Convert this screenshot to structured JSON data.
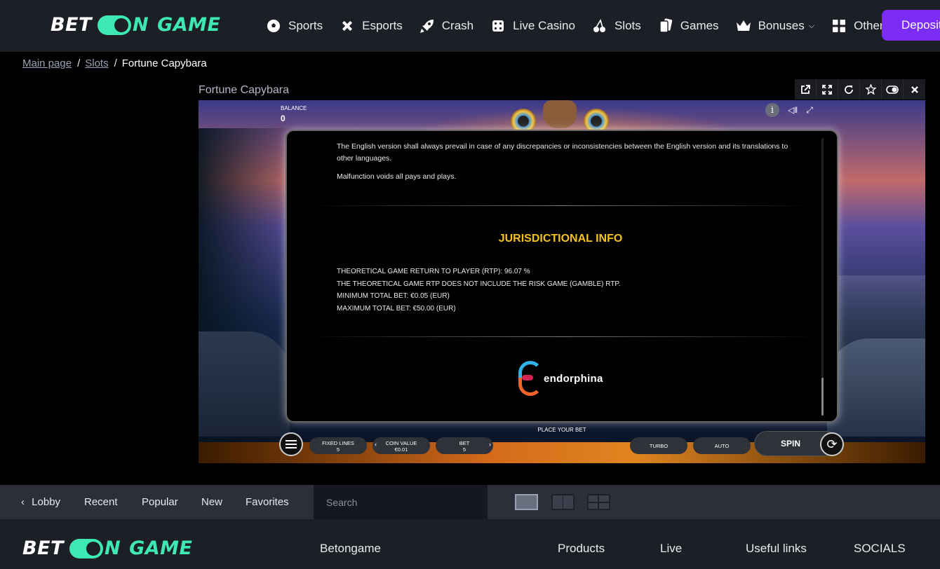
{
  "header": {
    "logo": {
      "bet": "BET",
      "on": "N",
      "game": "GAME"
    },
    "nav": [
      {
        "label": "Sports",
        "icon": "soccer-ball-icon"
      },
      {
        "label": "Esports",
        "icon": "gamepad-icon"
      },
      {
        "label": "Crash",
        "icon": "rocket-icon"
      },
      {
        "label": "Live Casino",
        "icon": "dice-icon"
      },
      {
        "label": "Slots",
        "icon": "cherries-icon"
      },
      {
        "label": "Games",
        "icon": "cards-icon"
      },
      {
        "label": "Bonuses",
        "icon": "crown-icon"
      },
      {
        "label": "Other",
        "icon": "grid-icon"
      }
    ],
    "deposit_label": "Deposit"
  },
  "breadcrumb": {
    "home": "Main page",
    "section": "Slots",
    "current": "Fortune Capybara"
  },
  "game": {
    "title": "Fortune Capybara",
    "balance_label": "BALANCE",
    "balance_value": "0",
    "info_icon": "i"
  },
  "panel": {
    "paragraph1": "The English version shall always prevail in case of any discrepancies or inconsistencies between the English version and its translations to other languages.",
    "paragraph2": "Malfunction voids all pays and plays.",
    "jurisdiction_title": "JURISDICTIONAL INFO",
    "rtp_lines": [
      "THEORETICAL GAME RETURN TO PLAYER (RTP): 96.07 %",
      "THE THEORETICAL GAME RTP DOES NOT INCLUDE THE RISK GAME (GAMBLE) RTP.",
      "MINIMUM TOTAL BET: €0.05 (EUR)",
      "MAXIMUM TOTAL BET: €50.00 (EUR)"
    ],
    "provider": "endorphina"
  },
  "controls": {
    "place_bet": "PLACE YOUR BET",
    "fixed_lines_label": "FIXED LINES",
    "fixed_lines_value": "5",
    "coin_value_label": "COIN VALUE",
    "coin_value_value": "€0.01",
    "bet_label": "BET",
    "bet_value": "5",
    "turbo": "TURBO",
    "auto": "AUTO",
    "spin": "SPIN"
  },
  "bottom_bar": {
    "lobby": "Lobby",
    "recent": "Recent",
    "popular": "Popular",
    "new": "New",
    "favorites": "Favorites",
    "search_placeholder": "Search"
  },
  "footer": {
    "betongame": "Betongame",
    "products": "Products",
    "live": "Live",
    "useful_links": "Useful links",
    "socials": "SOCIALS"
  },
  "colors": {
    "accent": "#3ee8b5",
    "deposit": "#7b2cf5",
    "jurisdiction": "#f5c21c"
  }
}
